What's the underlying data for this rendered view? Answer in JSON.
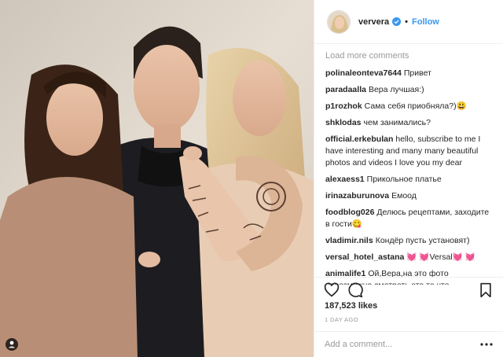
{
  "header": {
    "username": "ververa",
    "separator": "•",
    "follow_label": "Follow"
  },
  "comments_section": {
    "load_more": "Load more comments",
    "items": [
      {
        "user": "polinaleonteva7644",
        "text": "Привет"
      },
      {
        "user": "paradaalla",
        "text": "Вера лучшая:)"
      },
      {
        "user": "p1rozhok",
        "text": "Сама себя приобняла?)😃"
      },
      {
        "user": "shklodas",
        "text": "чем занимались?"
      },
      {
        "user": "official.erkebulan",
        "text": "hello, subscribe to me I have interesting and many many beautiful photos and videos I love you my dear"
      },
      {
        "user": "alexaess1",
        "text": "Прикольное платье"
      },
      {
        "user": "irinazaburunova",
        "text": "Емоод"
      },
      {
        "user": "foodblog026",
        "text": "Делюсь рецептами, заходите в гости😋"
      },
      {
        "user": "vladimir.nils",
        "text": "Кондёр пусть установят)"
      },
      {
        "user": "versal_hotel_astana",
        "text": "💓 💓Versal💓 💓"
      },
      {
        "user": "animalife1",
        "text": "Ой,Вера,на это фото невозможно смотреть,это то что называется три в одном🐵👑👑👑💔"
      }
    ]
  },
  "actions": {
    "like_icon": "heart-icon",
    "comment_icon": "comment-icon",
    "save_icon": "bookmark-icon"
  },
  "likes": "187,523 likes",
  "time_ago": "1 DAY AGO",
  "add_comment": {
    "placeholder": "Add a comment..."
  },
  "colors": {
    "link_blue": "#3897f0",
    "text": "#262626",
    "muted": "#999999",
    "border": "#efefef"
  }
}
